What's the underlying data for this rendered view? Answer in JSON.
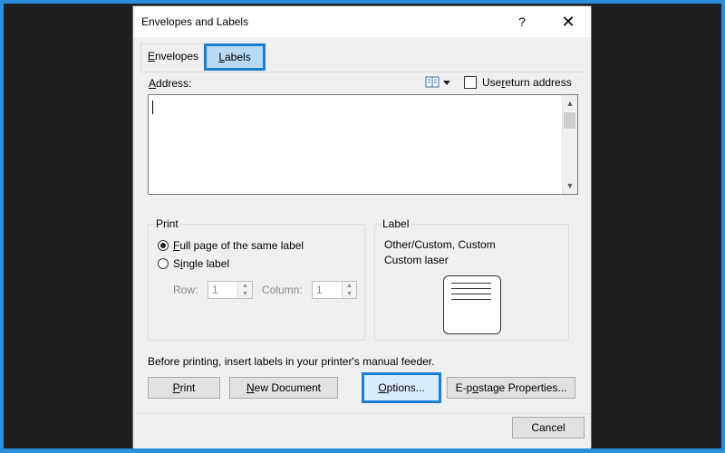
{
  "dialog": {
    "title": "Envelopes and Labels",
    "help_label": "?",
    "close_label": "✕"
  },
  "tabs": [
    {
      "pre": "",
      "u": "E",
      "post": "nvelopes"
    },
    {
      "pre": "",
      "u": "L",
      "post": "abels"
    }
  ],
  "address": {
    "label_u": "A",
    "label_post": "ddress:",
    "use_return_pre": "Use ",
    "use_return_u": "r",
    "use_return_post": "eturn address",
    "value": ""
  },
  "print_group": {
    "title": "Print",
    "full_page_u": "F",
    "full_page_post": "ull page of the same label",
    "single_pre": "S",
    "single_u": "i",
    "single_post": "ngle label",
    "row_label": "Row:",
    "row_value": "1",
    "column_label": "Column:",
    "column_value": "1"
  },
  "label_group": {
    "title": "Label",
    "line1": "Other/Custom, Custom",
    "line2": "Custom laser"
  },
  "note": "Before printing, insert labels in your printer's manual feeder.",
  "buttons": {
    "print_u": "P",
    "print_post": "rint",
    "newdoc_u": "N",
    "newdoc_post": "ew Document",
    "options_u": "O",
    "options_post": "ptions...",
    "epostage_pre": "E-p",
    "epostage_u": "o",
    "epostage_post": "stage Properties...",
    "cancel": "Cancel"
  },
  "colors": {
    "accent": "#1a7fd4",
    "outer_background": "#2a8fd8",
    "backdrop": "#1f1f1f"
  }
}
